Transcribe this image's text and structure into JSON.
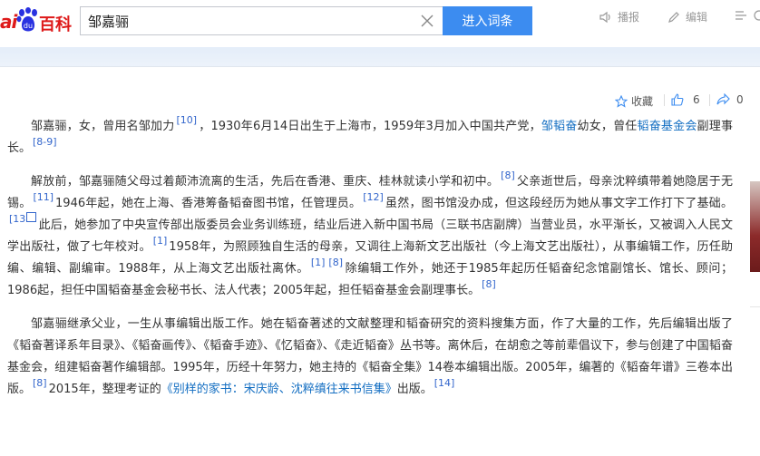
{
  "header": {
    "logo_bai": "ai",
    "logo_baike": "百科",
    "search_value": "邹嘉骊",
    "enter_button": "进入词条",
    "tools": {
      "play": "播报",
      "edit": "编辑"
    }
  },
  "actions": {
    "collect": "收藏",
    "like_count": "6",
    "share_count": "0"
  },
  "colors": {
    "accent": "#3c8cf0",
    "link": "#136ec2",
    "brand": "#de1a1a"
  },
  "paragraphs": {
    "p1": {
      "t1": "邹嘉骊，女，曾用名邹加力",
      "r1": "[10]",
      "t2": "，1930年6月14日出生于上海市，1959年3月加入中国共产党，",
      "l1": "邹韬奋",
      "t3": "幼女，曾任",
      "l2": "韬奋基金会",
      "t4": "副理事长。",
      "r2": "[8-9]"
    },
    "p2": {
      "t1": "解放前，邹嘉骊随父母过着颠沛流离的生活，先后在香港、重庆、桂林就读小学和初中。",
      "r1": "[8]",
      "t2": "父亲逝世后，母亲沈粹缜带着她隐居于无锡。",
      "r2": "[11]",
      "t3": "1946年起，她在上海、香港筹备韬奋图书馆，任管理员。",
      "r3": "[12]",
      "t4": "虽然，图书馆没办成，但这段经历为她从事文字工作打下了基础。",
      "r4": "[13",
      "t5": "此后，她参加了中央宣传部出版委员会业务训练班，结业后进入新中国书局（三联书店副牌）当营业员，水平渐长，又被调入人民文学出版社，做了七年校对。",
      "r5": "[1]",
      "t6": "1958年，为照顾独自生活的母亲，又调往上海新文艺出版社（今上海文艺出版社），从事编辑工作，历任助编、编辑、副编审。1988年，从上海文艺出版社离休。",
      "r6": "[1]",
      "r7": "[8]",
      "t7": "除编辑工作外，她还于1985年起历任韬奋纪念馆副馆长、馆长、顾问；1986起，担任中国韬奋基金会秘书长、法人代表；2005年起，担任韬奋基金会副理事长。",
      "r8": "[8]"
    },
    "p3": {
      "t1": "邹嘉骊继承父业，一生从事编辑出版工作。她在韬奋著述的文献整理和韬奋研究的资料搜集方面，作了大量的工作，先后编辑出版了《韬奋著译系年目录》、《韬奋画传》、《韬奋手迹》、《忆韬奋》、《走近韬奋》丛书等。离休后，在胡愈之等前辈倡议下，参与创建了中国韬奋基金会，组建韬奋著作编辑部。1995年，历经十年努力，她主持的《韬奋全集》14卷本编辑出版。2005年，编著的《韬奋年谱》三卷本出版。",
      "r1": "[8]",
      "t2": "2015年，整理考证的",
      "l1": "《别样的家书：宋庆龄、沈粹缜往来书信集》",
      "t3": "出版。",
      "r2": "[14]"
    }
  }
}
